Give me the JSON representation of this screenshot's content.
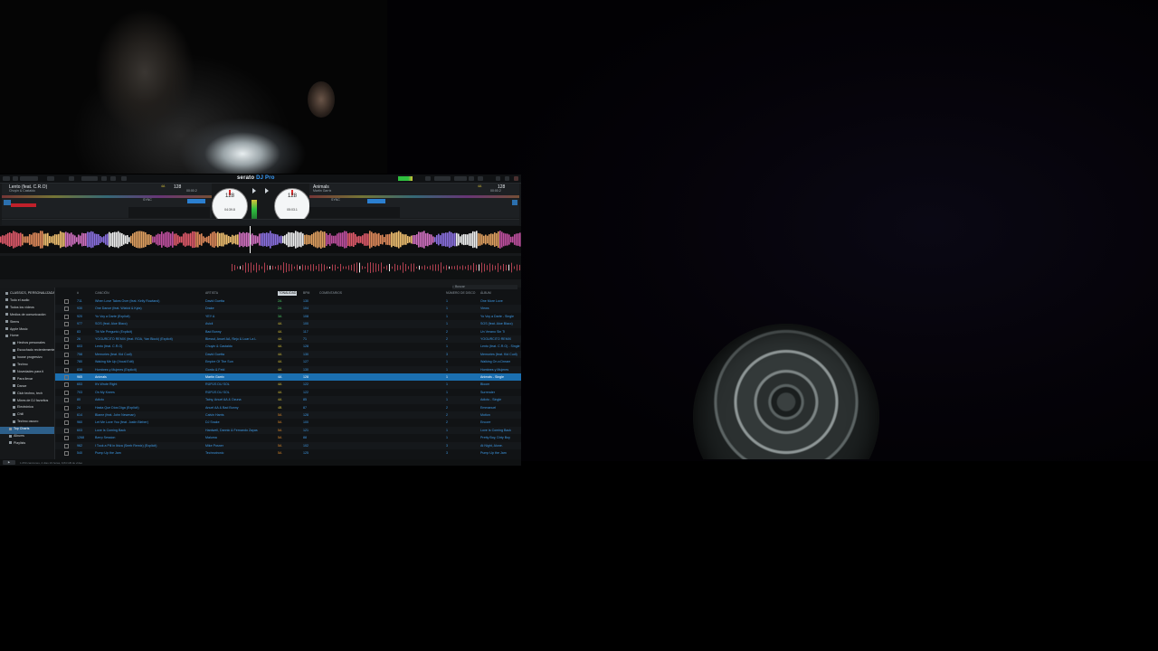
{
  "serato": {
    "brand": "serato",
    "edition": "DJ Pro",
    "deck_left": {
      "title": "Lento (feat. C.R.O)",
      "artist": "Chuyin & Castaldo",
      "bpm": "128",
      "key": "4A",
      "time_elapsed": "00:00.2",
      "time_remaining": "04:39.8",
      "platter_bpm": "128"
    },
    "deck_right": {
      "title": "Animals",
      "artist": "Martin Garrix",
      "bpm": "128",
      "key": "4A",
      "time_elapsed": "00:00.2",
      "time_remaining": "05:03.1",
      "platter_bpm": "128"
    },
    "sync_label": "SYNC",
    "search_placeholder": "Buscar",
    "sidebar": [
      {
        "label": "CLASSICS, PERSONALIZADA",
        "icon": "header"
      },
      {
        "label": "Todo el audio",
        "icon": "music-icon"
      },
      {
        "label": "Todos los vídeos",
        "icon": "video-icon"
      },
      {
        "label": "Medios de comunicación",
        "icon": "media-icon"
      },
      {
        "label": "Stems",
        "icon": "stems-icon"
      },
      {
        "label": "Apple Music",
        "icon": "apple-icon"
      },
      {
        "label": "Home",
        "icon": "home-icon"
      },
      {
        "label": "Hechos personales",
        "icon": "folder-icon"
      },
      {
        "label": "Escuchado recientemente",
        "icon": "folder-icon"
      },
      {
        "label": "house progresivo",
        "icon": "folder-icon"
      },
      {
        "label": "Techno",
        "icon": "folder-icon"
      },
      {
        "label": "Novedades para ti",
        "icon": "folder-icon"
      },
      {
        "label": "Para llevar",
        "icon": "folder-icon"
      },
      {
        "label": "Dance",
        "icon": "folder-icon"
      },
      {
        "label": "Club techno, tech",
        "icon": "folder-icon"
      },
      {
        "label": "Mixes de DJ favoritos",
        "icon": "folder-icon"
      },
      {
        "label": "Electrónica",
        "icon": "folder-icon"
      },
      {
        "label": "Chill",
        "icon": "folder-icon"
      },
      {
        "label": "Techno oscuro",
        "icon": "folder-icon"
      },
      {
        "label": "Top Charts",
        "icon": "chart-icon"
      },
      {
        "label": "Álbums",
        "icon": "album-icon"
      },
      {
        "label": "Playlists",
        "icon": "playlist-icon"
      }
    ],
    "columns": {
      "num": "#",
      "song": "CANCIÓN",
      "artist": "ARTISTA",
      "key": "TONALIDAD",
      "bpm": "BPM",
      "comments": "COMENTARIOS",
      "grouping": "NÚMERO DE DISCO",
      "album": "ÁLBUM"
    },
    "tracks": [
      {
        "n": "711",
        "song": "When Love Takes Over (feat. Kelly Rowland)",
        "artist": "David Guetta",
        "key": "2A",
        "kc": "g",
        "bpm": "130",
        "disc": "1",
        "album": "One More Love"
      },
      {
        "n": "930",
        "song": "One Dance (feat. Wizkid & Kyla)",
        "artist": "Drake",
        "key": "2A",
        "kc": "g",
        "bpm": "104",
        "disc": "1",
        "album": "Views"
      },
      {
        "n": "920",
        "song": "Yo Voy a Darte (Explicit)",
        "artist": "YEY A",
        "key": "3A",
        "kc": "g",
        "bpm": "108",
        "disc": "1",
        "album": "Yo Voy a Darte - Single"
      },
      {
        "n": "977",
        "song": "SOS (feat. Aloe Blacc)",
        "artist": "Avicii",
        "key": "4A",
        "kc": "y",
        "bpm": "100",
        "disc": "1",
        "album": "SOS (feat. Aloe Blacc)"
      },
      {
        "n": "83",
        "song": "Tití Me Preguntó (Explicit)",
        "artist": "Bad Bunny",
        "key": "4A",
        "kc": "y",
        "bpm": "117",
        "disc": "2",
        "album": "Un Verano Sin Ti"
      },
      {
        "n": "26",
        "song": "YOGURCITO REMIX (feat. ROA, Yan Block) (Explicit)",
        "artist": "Blessd, Anuel AA, Ñejo & Luar La L",
        "key": "4A",
        "kc": "y",
        "bpm": "71",
        "disc": "2",
        "album": "YOGURCITO REMIX"
      },
      {
        "n": "603",
        "song": "Lento (feat. C.R.O)",
        "artist": "Chuyin & Castaldo",
        "key": "4A",
        "kc": "y",
        "bpm": "128",
        "disc": "1",
        "album": "Lento (feat. C.R.O) - Single"
      },
      {
        "n": "758",
        "song": "Memories (feat. Kid Cudi)",
        "artist": "David Guetta",
        "key": "4A",
        "kc": "y",
        "bpm": "130",
        "disc": "3",
        "album": "Memories (feat. Kid Cudi)"
      },
      {
        "n": "780",
        "song": "Waking Me Up (Vocal Edit)",
        "artist": "Empire Of The Sun",
        "key": "4A",
        "kc": "y",
        "bpm": "127",
        "disc": "1",
        "album": "Walking On a Dream"
      },
      {
        "n": "838",
        "song": "Hombres y Mujeres (Explicit)",
        "artist": "Gordo & Feid",
        "key": "4A",
        "kc": "y",
        "bpm": "130",
        "disc": "1",
        "album": "Hombres y Mujeres"
      },
      {
        "n": "965",
        "song": "Animals",
        "artist": "Martin Garrix",
        "key": "4A",
        "kc": "y",
        "bpm": "128",
        "disc": "1",
        "album": "Animals - Single"
      },
      {
        "n": "653",
        "song": "It's Wrote Right",
        "artist": "RÜFÜS DU SOL",
        "key": "4A",
        "kc": "y",
        "bpm": "122",
        "disc": "1",
        "album": "Bloom"
      },
      {
        "n": "703",
        "song": "On My Knees",
        "artist": "RÜFÜS DU SOL",
        "key": "4A",
        "kc": "y",
        "bpm": "122",
        "disc": "1",
        "album": "Surrender"
      },
      {
        "n": "80",
        "song": "Adicto",
        "artist": "Tainy, Anuel AA & Ozuna",
        "key": "4A",
        "kc": "y",
        "bpm": "85",
        "disc": "1",
        "album": "Adicto - Single"
      },
      {
        "n": "24",
        "song": "Hasta Que Dios Diga (Explicit)",
        "artist": "Anuel AA & Bad Bunny",
        "key": "4B",
        "kc": "y",
        "bpm": "87",
        "disc": "2",
        "album": "Emmanuel"
      },
      {
        "n": "614",
        "song": "Blame (feat. John Newman)",
        "artist": "Calvin Harris",
        "key": "5A",
        "kc": "o",
        "bpm": "128",
        "disc": "2",
        "album": "Motion"
      },
      {
        "n": "960",
        "song": "Let Me Love You (feat. Justin Bieber)",
        "artist": "DJ Snake",
        "key": "5A",
        "kc": "o",
        "bpm": "100",
        "disc": "2",
        "album": "Encore"
      },
      {
        "n": "603",
        "song": "Love Is Coming Back",
        "artist": "Hardwell, Dannic & Fernando Zayas",
        "key": "5A",
        "kc": "o",
        "bpm": "121",
        "disc": "1",
        "album": "Love Is Coming Back"
      },
      {
        "n": "1268",
        "song": "Bzrrp Session",
        "artist": "Maluma",
        "key": "5A",
        "kc": "o",
        "bpm": "88",
        "disc": "1",
        "album": "Pretty Boy, Dirty Boy"
      },
      {
        "n": "962",
        "song": "I Took a Pill in Ibiza (Seeb Remix) (Explicit)",
        "artist": "Mike Posner",
        "key": "5A",
        "kc": "o",
        "bpm": "102",
        "disc": "3",
        "album": "At Night, Alone."
      },
      {
        "n": "540",
        "song": "Pump Up the Jam",
        "artist": "Technotronic",
        "key": "5A",
        "kc": "o",
        "bpm": "125",
        "disc": "3",
        "album": "Pump Up the Jam"
      }
    ],
    "status_text": "1.050 canciones, 4 días 19 horas, 9,84 GB de vídeo"
  }
}
